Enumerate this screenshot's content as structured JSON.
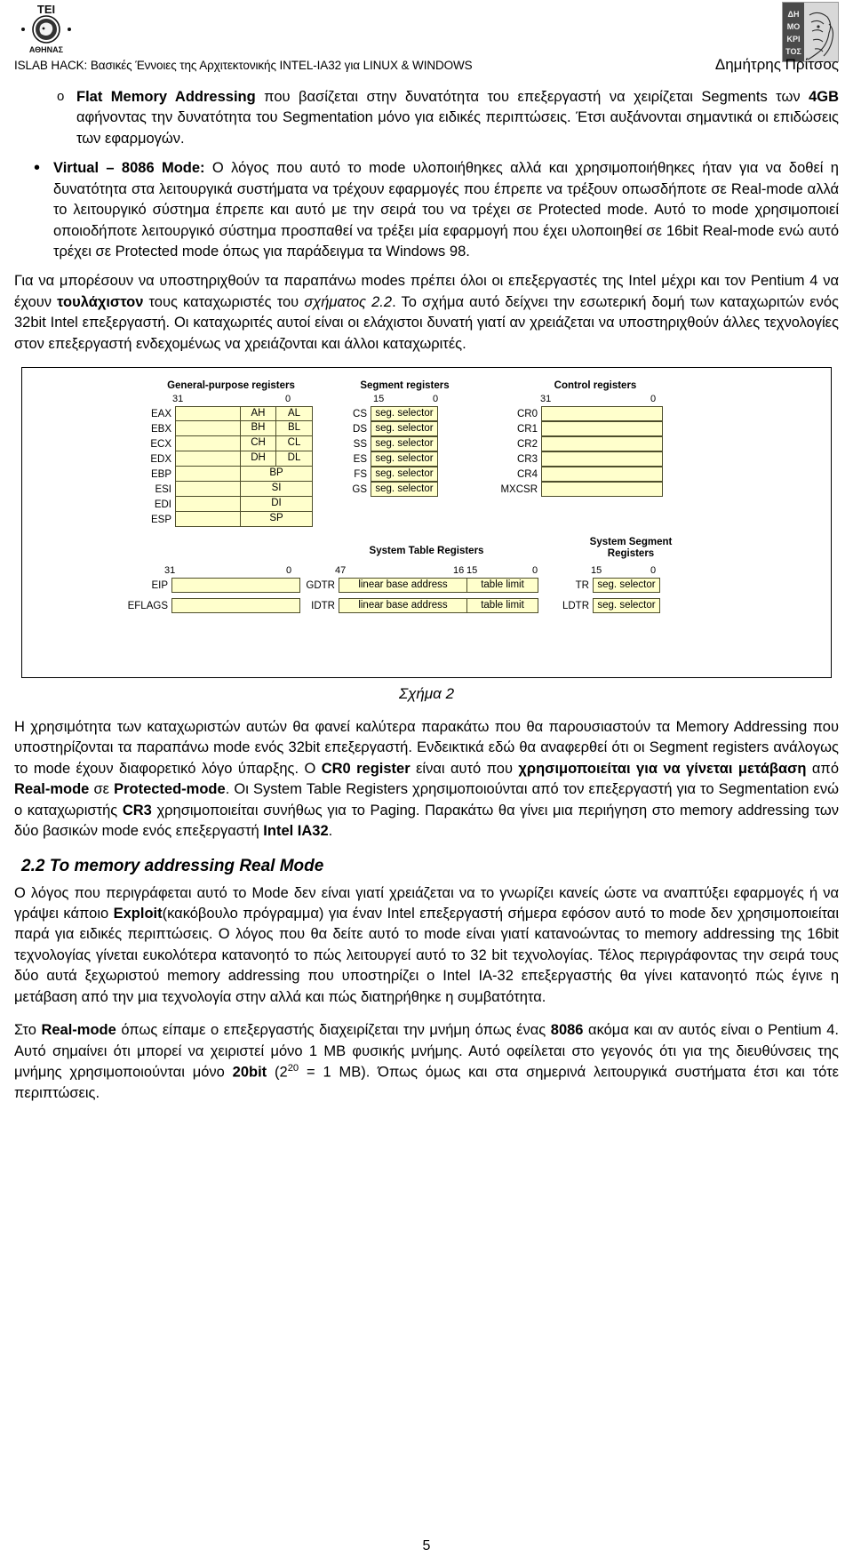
{
  "header": {
    "title": "ISLAB HACK: Βασικές Έννοιες της Αρχιτεκτονικής INTEL-IA32 για LINUX & WINDOWS",
    "author": "Δημήτρης Πρίτσος",
    "left_logo_name": "tei-athens-logo",
    "right_logo_name": "dimokritos-logo",
    "left_logo_text_top": "ΤΕΙ",
    "left_logo_text_bottom": "ΑΘΗΝΑΣ",
    "right_logo_text": "ΔΗΜΟΚΡΙΤΟΣ"
  },
  "bullets": [
    {
      "marker": "o",
      "lead": "Flat Memory Addressing",
      "text_a": " που βασίζεται στην δυνατότητα του επεξεργαστή να χειρίζεται Segments των ",
      "bold_b": "4GB",
      "text_b": " αφήνοντας την δυνατότητα του Segmentation μόνο για ειδικές περιπτώσεις. Έτσι αυξάνονται σημαντικά οι επιδώσεις των εφαρμογών."
    },
    {
      "marker": "•",
      "lead": "Virtual – 8086 Mode:",
      "text_a": " Ο λόγος που αυτό το mode υλοποιήθηκες αλλά και χρησιμοποιήθηκες ήταν για να δοθεί η δυνατότητα στα λειτουργικά συστήματα να τρέχουν εφαρμογές που έπρεπε να τρέξουν οπωσδήποτε σε Real-mode αλλά το λειτουργικό σύστημα έπρεπε και αυτό με την σειρά του να τρέχει σε Protected mode. Αυτό το mode χρησιμοποιεί οποιοδήποτε λειτουργικό σύστημα προσπαθεί να τρέξει μία εφαρμογή που έχει υλοποιηθεί σε 16bit Real-mode ενώ αυτό τρέχει σε Protected mode όπως για παράδειγμα τα Windows 98."
    }
  ],
  "paragraphs": {
    "p1_a": "Για να μπορέσουν να υποστηριχθούν τα παραπάνω modes πρέπει όλοι οι επεξεργαστές της Intel μέχρι και τον Pentium 4 να έχουν ",
    "p1_bold1": "τουλάχιστον",
    "p1_b": " τους καταχωριστές του ",
    "p1_italic1": "σχήματος 2.2",
    "p1_c": ". Το σχήμα αυτό δείχνει την εσωτερική δομή των καταχωριτών ενός 32bit Intel επεξεργαστή. Οι καταχωριτές αυτοί είναι οι ελάχιστοι δυνατή γιατί αν χρειάζεται να υποστηριχθούν άλλες τεχνολογίες στον επεξεργαστή ενδεχομένως να χρειάζονται και άλλοι καταχωριτές.",
    "p2_a": "Η χρησιμότητα των καταχωριστών αυτών θα φανεί καλύτερα παρακάτω που θα παρουσιαστούν τα Memory Addressing που υποστηρίζονται τα παραπάνω mode ενός 32bit επεξεργαστή. Ενδεικτικά εδώ θα αναφερθεί ότι οι Segment registers ανάλογως το mode έχουν διαφορετικό λόγο ύπαρξης. Ο ",
    "p2_bold1": "CR0 register",
    "p2_b": " είναι αυτό που ",
    "p2_bold2": "χρησιμοποιείται για να γίνεται μετάβαση",
    "p2_c": " από ",
    "p2_bold3": "Real-mode",
    "p2_d": " σε ",
    "p2_bold4": "Protected-mode",
    "p2_e": ". Οι System Table Registers χρησιμοποιούνται από τον επεξεργαστή για το Segmentation ενώ ο καταχωριστής ",
    "p2_bold5": "CR3",
    "p2_f": " χρησιμοποιείται συνήθως για το Paging. Παρακάτω θα γίνει μια περιήγηση στο memory addressing των δύο βασικών mode ενός επεξεργαστή ",
    "p2_bold6": "Intel IA32",
    "p2_g": ".",
    "p3_a": "Ο λόγος που περιγράφεται αυτό το Mode δεν είναι γιατί χρειάζεται να το γνωρίζει κανείς ώστε να αναπτύξει εφαρμογές ή να γράψει κάποιο ",
    "p3_bold1": "Exploit",
    "p3_b": "(κακόβουλο πρόγραμμα) για έναν Intel επεξεργαστή σήμερα εφόσον αυτό το mode δεν χρησιμοποιείται παρά για ειδικές περιπτώσεις. Ο λόγος που θα δείτε αυτό το mode είναι γιατί κατανοώντας το memory addressing της 16bit τεχνολογίας γίνεται ευκολότερα κατανοητό το πώς λειτουργεί αυτό το 32 bit τεχνολογίας. Τέλος περιγράφοντας την σειρά τους δύο αυτά ξεχωριστού memory addressing που υποστηρίζει ο Intel IA-32 επεξεργαστής θα γίνει κατανοητό πώς έγινε η μετάβαση από την μια τεχνολογία στην αλλά και πώς διατηρήθηκε η συμβατότητα.",
    "p4_a": "Στο ",
    "p4_bold1": "Real-mode",
    "p4_b": " όπως είπαμε ο επεξεργαστής διαχειρίζεται την μνήμη όπως ένας ",
    "p4_bold2": "8086",
    "p4_c": " ακόμα και αν αυτός είναι ο Pentium 4. Αυτό σημαίνει ότι μπορεί να χειριστεί μόνο 1 MB φυσικής μνήμης. Αυτό οφείλεται στο γεγονός ότι για της διευθύνσεις της μνήμης χρησιμοποιούνται μόνο ",
    "p4_bold3": "20bit",
    "p4_d": " (2",
    "p4_sup": "20",
    "p4_e": " = 1 MB). Όπως όμως και στα σημερινά λειτουργικά συστήματα έτσι και τότε περιπτώσεις."
  },
  "section": {
    "heading": "2.2 To memory addressing Real Mode"
  },
  "figure": {
    "caption": "Σχήμα 2",
    "cell_color": "#ffffcc",
    "border_color": "#4d4d2b",
    "groups": {
      "gp": {
        "title": "General-purpose registers",
        "bit_high": "31",
        "bit_low": "0",
        "rows": [
          {
            "name": "EAX",
            "cells": [
              "",
              "AH",
              "AL"
            ]
          },
          {
            "name": "EBX",
            "cells": [
              "",
              "BH",
              "BL"
            ]
          },
          {
            "name": "ECX",
            "cells": [
              "",
              "CH",
              "CL"
            ]
          },
          {
            "name": "EDX",
            "cells": [
              "",
              "DH",
              "DL"
            ]
          },
          {
            "name": "EBP",
            "cells": [
              "",
              "BP"
            ]
          },
          {
            "name": "ESI",
            "cells": [
              "",
              "SI"
            ]
          },
          {
            "name": "EDI",
            "cells": [
              "",
              "DI"
            ]
          },
          {
            "name": "ESP",
            "cells": [
              "",
              "SP"
            ]
          }
        ]
      },
      "segment": {
        "title": "Segment registers",
        "bit_high": "15",
        "bit_low": "0",
        "cell_label": "seg. selector",
        "rows": [
          {
            "name": "CS"
          },
          {
            "name": "DS"
          },
          {
            "name": "SS"
          },
          {
            "name": "ES"
          },
          {
            "name": "FS"
          },
          {
            "name": "GS"
          }
        ]
      },
      "control": {
        "title": "Control registers",
        "bit_high": "31",
        "bit_low": "0",
        "rows": [
          {
            "name": "CR0"
          },
          {
            "name": "CR1"
          },
          {
            "name": "CR2"
          },
          {
            "name": "CR3"
          },
          {
            "name": "CR4"
          },
          {
            "name": "MXCSR"
          }
        ]
      },
      "instruction": {
        "bit_high": "31",
        "bit_low": "0",
        "rows": [
          {
            "name": "EIP"
          },
          {
            "name": "EFLAGS"
          }
        ]
      },
      "system_table": {
        "title": "System Table Registers",
        "bit_47": "47",
        "bit_16": "16",
        "bit_15": "15",
        "bit_0": "0",
        "cell_a": "linear base address",
        "cell_b": "table limit",
        "rows": [
          {
            "name": "GDTR"
          },
          {
            "name": "IDTR"
          }
        ]
      },
      "system_segment": {
        "title_line1": "System Segment",
        "title_line2": "Registers",
        "bit_high": "15",
        "bit_low": "0",
        "cell_label": "seg. selector",
        "rows": [
          {
            "name": "TR"
          },
          {
            "name": "LDTR"
          }
        ]
      }
    }
  },
  "footer": {
    "page_number": "5"
  }
}
